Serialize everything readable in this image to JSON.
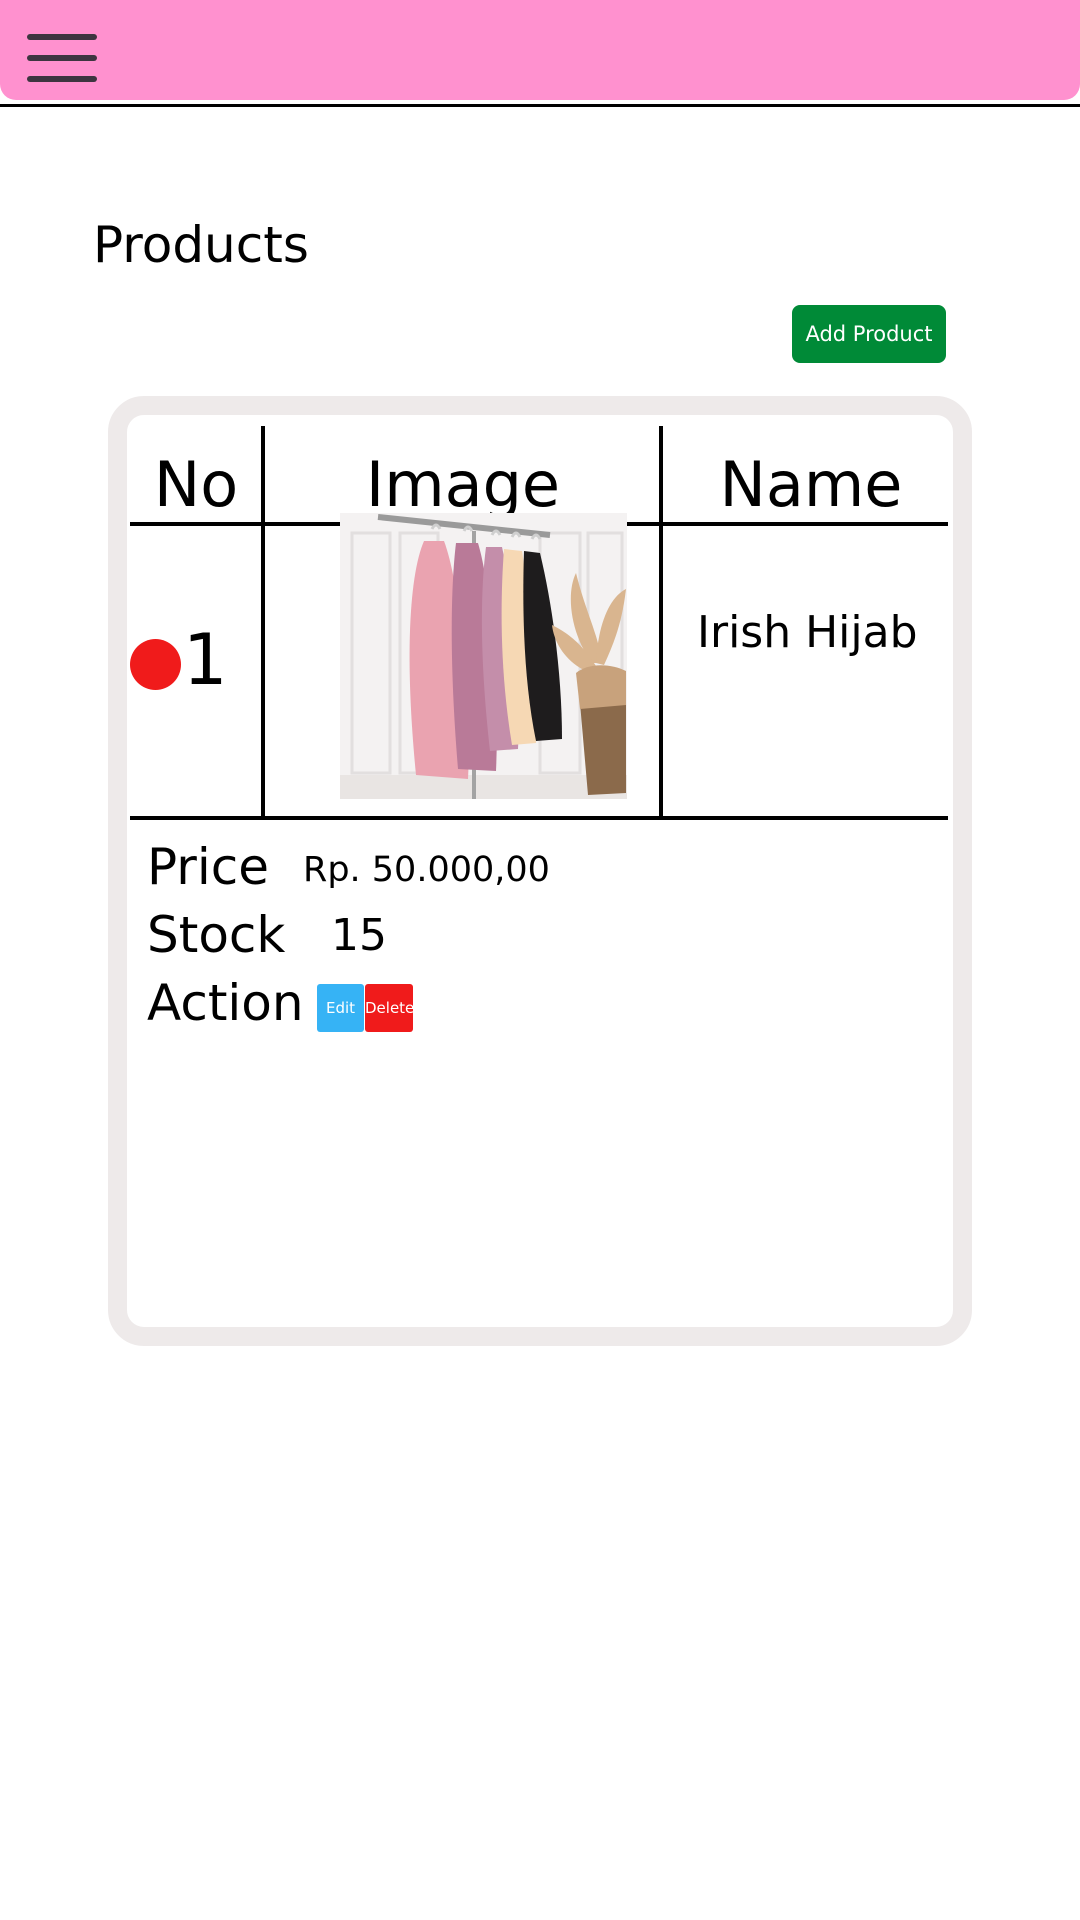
{
  "header": {
    "menu_icon": "hamburger-menu-icon",
    "background_color": "#ff91cf"
  },
  "page": {
    "title": "Products",
    "add_button_label": "Add Product",
    "add_button_color": "#008a37"
  },
  "table": {
    "columns": [
      "No",
      "Image",
      "Name"
    ],
    "rows": [
      {
        "no": "1",
        "image": "clothes-on-rack-photo",
        "name": "Irish Hijab",
        "price_label": "Price",
        "price": "Rp. 50.000,00",
        "stock_label": "Stock",
        "stock": "15",
        "action_label": "Action",
        "edit_label": "Edit",
        "delete_label": "Delete",
        "status_dot_color": "#f01b1b"
      }
    ]
  },
  "colors": {
    "edit_button": "#36b3f5",
    "delete_button": "#f01b1b",
    "card_border": "#eeeaea"
  }
}
